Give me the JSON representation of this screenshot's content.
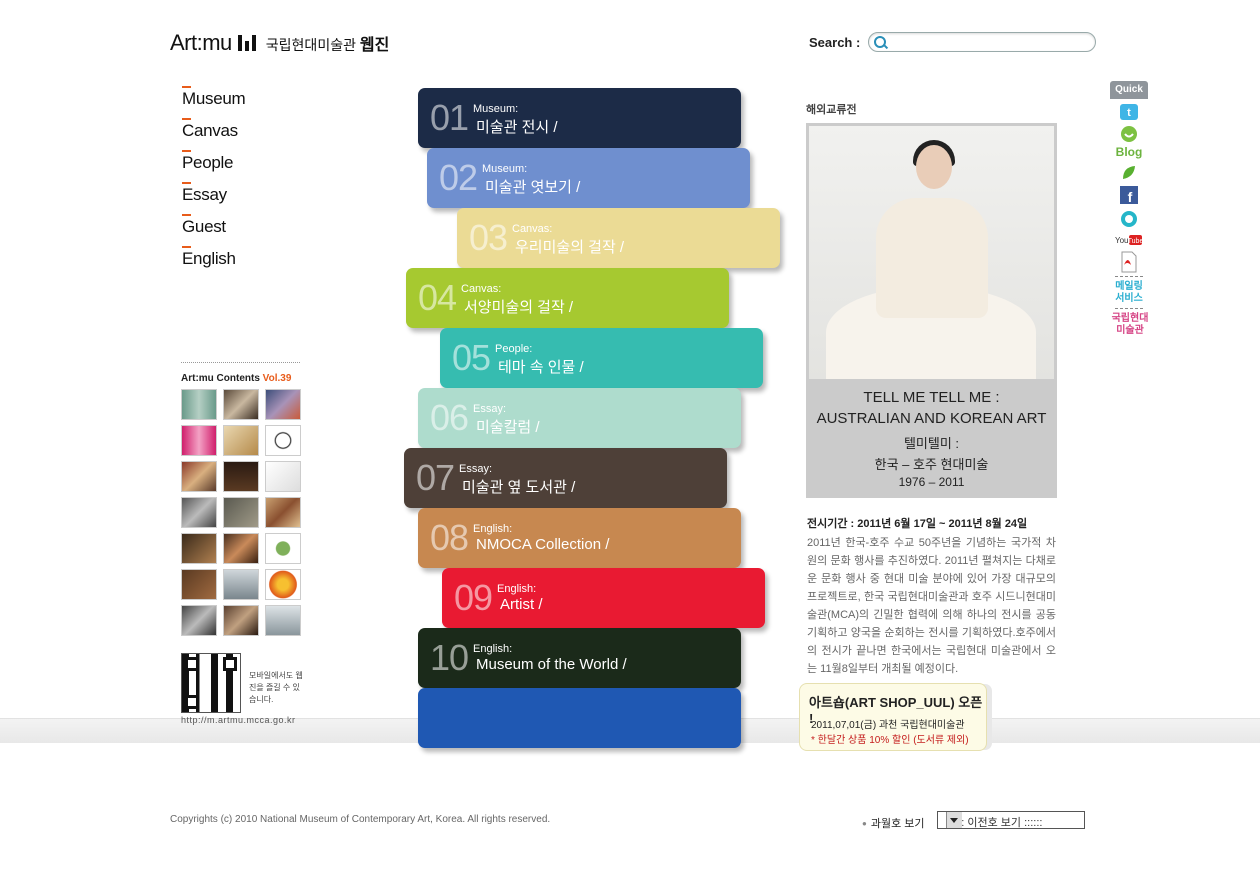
{
  "header": {
    "brand": "Art:mu",
    "sub_normal": "국립현대미술관 ",
    "sub_bold": "웹진",
    "search_label": "Search :",
    "search_placeholder": ""
  },
  "menu": [
    "Museum",
    "Canvas",
    "People",
    "Essay",
    "Guest",
    "English"
  ],
  "contents": {
    "brand": "Art:mu Contents",
    "vol": "Vol.39"
  },
  "qr": {
    "text": "모바일에서도 웹진을 즐길 수 있습니다.",
    "url": "http://m.artmu.mcca.go.kr"
  },
  "tabs": [
    {
      "num": "01",
      "cat": "Museum:",
      "title": "미술관 전시 /",
      "color": "#1c2b47"
    },
    {
      "num": "02",
      "cat": "Museum:",
      "title": "미술관 엿보기 /",
      "color": "#6f8fcf"
    },
    {
      "num": "03",
      "cat": "Canvas:",
      "title": "우리미술의 걸작 /",
      "color": "#ebdb95"
    },
    {
      "num": "04",
      "cat": "Canvas:",
      "title": "서양미술의 걸작 /",
      "color": "#a6c930"
    },
    {
      "num": "05",
      "cat": "People:",
      "title": "테마 속 인물 /",
      "color": "#36bcb0"
    },
    {
      "num": "06",
      "cat": "Essay:",
      "title": "미술칼럼 /",
      "color": "#aedccd"
    },
    {
      "num": "07",
      "cat": "Essay:",
      "title": "미술관 옆 도서관 /",
      "color": "#4e4038"
    },
    {
      "num": "08",
      "cat": "English:",
      "title": "NMOCA Collection /",
      "color": "#c78850"
    },
    {
      "num": "09",
      "cat": "English:",
      "title": "Artist /",
      "color": "#e91a32"
    },
    {
      "num": "10",
      "cat": "English:",
      "title": "Museum of the World /",
      "color": "#1b2a1a"
    },
    {
      "num": "",
      "cat": "",
      "title": "",
      "color": "#1f58b3"
    }
  ],
  "exhibition": {
    "label": "해외교류전",
    "title_en1": "TELL ME TELL ME :",
    "title_en2": "AUSTRALIAN AND KOREAN ART",
    "title_ko1": "텔미텔미 :",
    "title_ko2": "한국 – 호주 현대미술",
    "years": "1976 – 2011",
    "period": "전시기간 : 2011년 6월 17일 ~ 2011년 8월 24일",
    "description": "2011년 한국-호주 수교 50주년을 기념하는 국가적 차원의 문화 행사를 추진하였다. 2011년 펼쳐지는 다채로운 문화 행사 중 현대 미술 분야에 있어 가장 대규모의 프로젝트로, 한국 국립현대미술관과 호주 시드니현대미술관(MCA)의 긴밀한 협력에 의해 하나의 전시를 공동 기획하고 양국을 순회하는 전시를 기획하였다.호주에서의 전시가 끝나면 한국에서는 국립현대 미술관에서 오는 11월8일부터 개최될 예정이다."
  },
  "shop": {
    "heading": "아트숍(ART SHOP_UUL) 오픈 !",
    "date": "2011,07,01(금) 과천 국립현대미술관",
    "note": "* 한달간 상품 10% 할인 (도서류 제외)"
  },
  "quick": {
    "header": "Quick",
    "blog": "Blog",
    "mailing": "메일링 서비스",
    "museum": "국립현대 미술관"
  },
  "footer": {
    "copyright": "Copyrights (c) 2010 National Museum of Contemporary Art, Korea.  All rights reserved.",
    "past_label": "과월호 보기",
    "select_value": ":::::: 이전호 보기 ::::::"
  }
}
